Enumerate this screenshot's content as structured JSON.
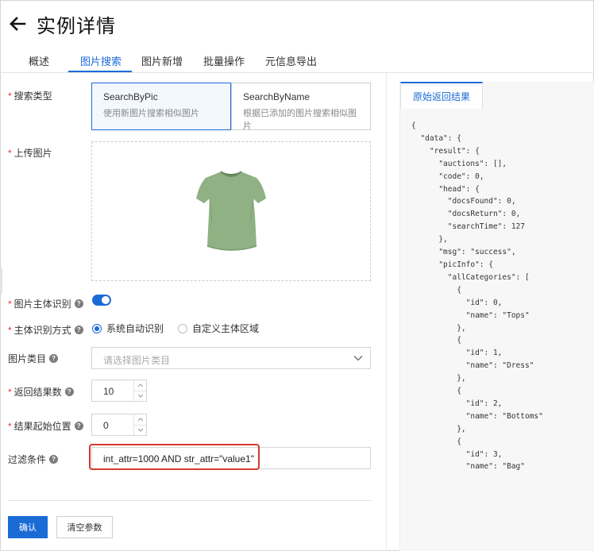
{
  "header": {
    "title": "实例详情",
    "back_icon": "arrow-left-icon"
  },
  "tabs": [
    {
      "label": "概述",
      "active": false
    },
    {
      "label": "图片搜索",
      "active": true
    },
    {
      "label": "图片新增",
      "active": false
    },
    {
      "label": "批量操作",
      "active": false
    },
    {
      "label": "元信息导出",
      "active": false
    }
  ],
  "accent_color": "#1a6bd6",
  "required_mark": "*",
  "form": {
    "search_type": {
      "label": "搜索类型",
      "options": [
        {
          "title": "SearchByPic",
          "desc": "使用新图片搜索相似图片",
          "selected": true
        },
        {
          "title": "SearchByName",
          "desc": "根据已添加的图片搜索相似图片",
          "selected": false
        }
      ]
    },
    "upload": {
      "label": "上传图片",
      "image": "green-tshirt"
    },
    "subject_detect": {
      "label": "图片主体识别",
      "enabled": true
    },
    "detect_mode": {
      "label": "主体识别方式",
      "options": [
        {
          "label": "系统自动识别",
          "checked": true
        },
        {
          "label": "自定义主体区域",
          "checked": false
        }
      ]
    },
    "category": {
      "label": "图片类目",
      "placeholder": "请选择图片类目"
    },
    "result_count": {
      "label": "返回结果数",
      "value": "10"
    },
    "start_position": {
      "label": "结果起始位置",
      "value": "0"
    },
    "filter": {
      "label": "过滤条件",
      "value": "int_attr=1000 AND str_attr=\"value1\""
    }
  },
  "buttons": {
    "confirm": "确认",
    "clear": "清空参数"
  },
  "result_panel": {
    "tab_label": "原始返回结果",
    "json_text": "{\n  \"data\": {\n    \"result\": {\n      \"auctions\": [],\n      \"code\": 0,\n      \"head\": {\n        \"docsFound\": 0,\n        \"docsReturn\": 0,\n        \"searchTime\": 127\n      },\n      \"msg\": \"success\",\n      \"picInfo\": {\n        \"allCategories\": [\n          {\n            \"id\": 0,\n            \"name\": \"Tops\"\n          },\n          {\n            \"id\": 1,\n            \"name\": \"Dress\"\n          },\n          {\n            \"id\": 2,\n            \"name\": \"Bottoms\"\n          },\n          {\n            \"id\": 3,\n            \"name\": \"Bag\""
  }
}
